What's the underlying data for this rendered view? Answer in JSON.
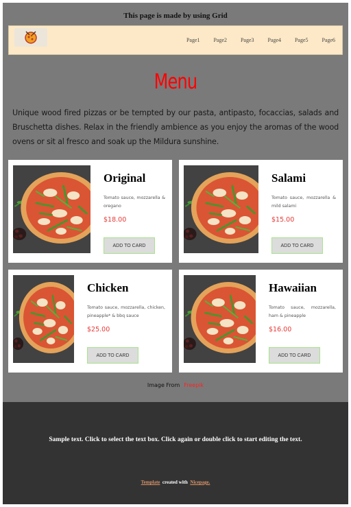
{
  "top_note": "This page is made by using Grid",
  "nav": {
    "logo_icon": "pizza-logo-icon",
    "links": [
      "Page1",
      "Page2",
      "Page3",
      "Page4",
      "Page5",
      "Page6"
    ]
  },
  "menu": {
    "title": "Menu",
    "intro": "Unique wood fired pizzas or be tempted by our pasta, antipasto, focaccias, salads and Bruschetta dishes. Relax in the friendly ambience as you enjoy the aromas of the wood ovens or sit al fresco and soak up the Mildura sunshine."
  },
  "cards": [
    {
      "name": "Original",
      "desc": "Tomato sauce, mozzarella & oregano",
      "price": "$18.00",
      "button": "ADD TO CARD"
    },
    {
      "name": "Salami",
      "desc": "Tomato sauce, mozzarella & mild salami",
      "price": "$15.00",
      "button": "ADD TO CARD"
    },
    {
      "name": "Chicken",
      "desc": "Tomato sauce, mozzarella, chicken, pineapple* & bbq sauce",
      "price": "$25.00",
      "button": "ADD TO CARD"
    },
    {
      "name": "Hawaiian",
      "desc": "Tomato sauce, mozzarella, ham & pineapple",
      "price": "$16.00",
      "button": "ADD TO CARD"
    }
  ],
  "credit": {
    "label": "Image From",
    "link": "Freepik"
  },
  "footer": {
    "text": "Sample text. Click to select the text box. Click again or double click to start editing the text.",
    "template_link": "Template",
    "created_with": "created with",
    "nicepage_link": "Nicepage."
  },
  "colors": {
    "accent": "#ff0000",
    "price": "#e53935",
    "nav_bg": "#fde9c7",
    "page_bg": "#7a7a7a",
    "footer_bg": "#333333",
    "button_border": "#a7e38b"
  }
}
